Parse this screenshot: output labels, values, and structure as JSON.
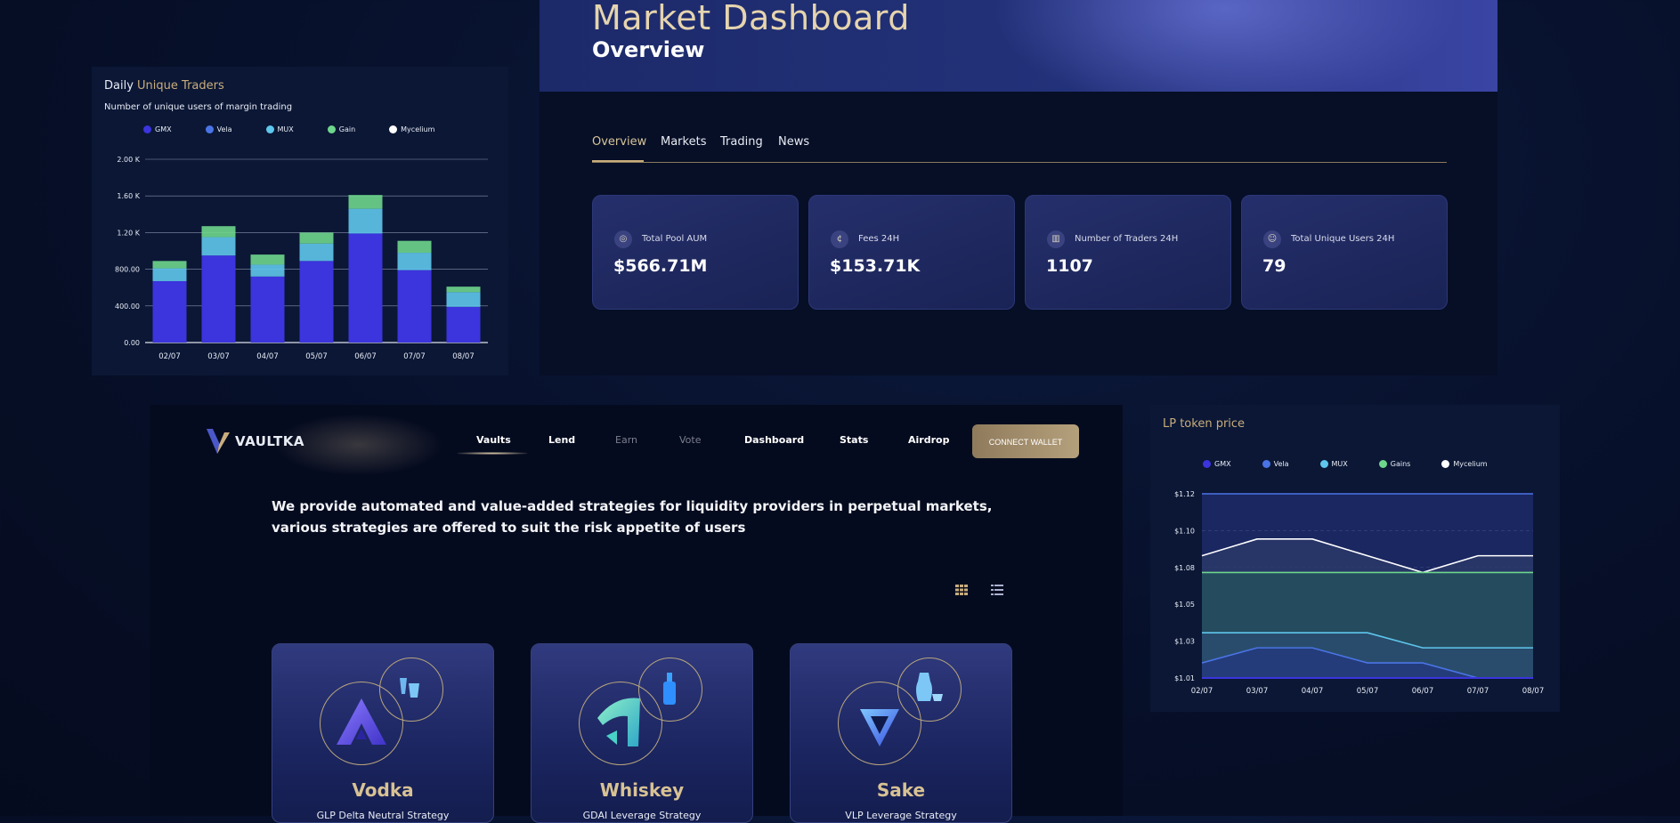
{
  "traders": {
    "title_prefix": "Daily",
    "title_highlight": "Unique Traders",
    "subtitle": "Number of unique users of margin trading",
    "legend": [
      "GMX",
      "Vela",
      "MUX",
      "Gain",
      "Mycelium"
    ]
  },
  "lp": {
    "title": "LP token price",
    "legend": [
      "GMX",
      "Vela",
      "MUX",
      "Gains",
      "Mycelium"
    ]
  },
  "colors": {
    "gmx": "#3c34dd",
    "vela": "#4a74e6",
    "mux": "#5fc6ec",
    "gain": "#6ed68c",
    "mycelium": "#ffffff",
    "gold": "#c9ad7d",
    "panel": "#0b1735"
  },
  "chart_data": [
    {
      "type": "bar",
      "stacked": true,
      "title": "Daily Unique Traders",
      "subtitle": "Number of unique users of margin trading",
      "categories": [
        "02/07",
        "03/07",
        "04/07",
        "05/07",
        "06/07",
        "07/07",
        "08/07"
      ],
      "series": [
        {
          "name": "GMX",
          "values": [
            670,
            950,
            720,
            890,
            1190,
            790,
            390
          ]
        },
        {
          "name": "MUX",
          "values": [
            140,
            200,
            130,
            190,
            270,
            190,
            160
          ]
        },
        {
          "name": "Gain",
          "values": [
            80,
            120,
            110,
            120,
            150,
            130,
            60
          ]
        }
      ],
      "yticks": [
        "0.00",
        "400.00",
        "800.00",
        "1.20 K",
        "1.60 K",
        "2.00 K"
      ],
      "ylim": [
        0,
        2000
      ],
      "legend": [
        "GMX",
        "Vela",
        "MUX",
        "Gain",
        "Mycelium"
      ],
      "legend_position": "top",
      "grid": true
    },
    {
      "type": "area",
      "title": "LP token price",
      "x": [
        "02/07",
        "03/07",
        "04/07",
        "05/07",
        "06/07",
        "07/07",
        "08/07"
      ],
      "series": [
        {
          "name": "Mycelium",
          "values": [
            1.083,
            1.093,
            1.093,
            1.083,
            1.073,
            1.083,
            1.083
          ]
        },
        {
          "name": "Gains",
          "values": [
            1.073,
            1.073,
            1.073,
            1.073,
            1.073,
            1.073,
            1.073
          ]
        },
        {
          "name": "MUX",
          "values": [
            1.037,
            1.037,
            1.037,
            1.037,
            1.028,
            1.028,
            1.028
          ]
        },
        {
          "name": "Vela",
          "values": [
            1.019,
            1.028,
            1.028,
            1.019,
            1.019,
            1.01,
            1.01
          ]
        },
        {
          "name": "GMX",
          "values": [
            1.01,
            1.01,
            1.01,
            1.01,
            1.01,
            1.01,
            1.01
          ]
        }
      ],
      "yticks": [
        "$1.01",
        "$1.03",
        "$1.05",
        "$1.08",
        "$1.10",
        "$1.12"
      ],
      "ylim": [
        1.01,
        1.12
      ],
      "legend": [
        "GMX",
        "Vela",
        "MUX",
        "Gains",
        "Mycelium"
      ],
      "legend_position": "top",
      "grid": true
    }
  ],
  "market": {
    "title": "Market Dashboard",
    "subtitle": "Overview",
    "tabs": [
      "Overview",
      "Markets",
      "Trading",
      "News"
    ],
    "active_tab": "Overview",
    "cards": [
      {
        "label": "Total Pool AUM",
        "value": "$566.71M",
        "icon": "pool-icon"
      },
      {
        "label": "Fees 24H",
        "value": "$153.71K",
        "icon": "fees-icon"
      },
      {
        "label": "Number of Traders 24H",
        "value": "1107",
        "icon": "bar-chart-icon"
      },
      {
        "label": "Total Unique Users 24H",
        "value": "79",
        "icon": "user-icon"
      }
    ]
  },
  "vaultka": {
    "logo": "VAULTKA",
    "nav": [
      "Vaults",
      "Lend",
      "Earn",
      "Vote",
      "Dashboard",
      "Stats",
      "Airdrop"
    ],
    "connect": "CONNECT WALLET",
    "tagline": "We provide automated and value-added strategies for liquidity providers in perpetual markets, various strategies are offered to suit the risk appetite of users",
    "vaults": [
      {
        "name": "Vodka",
        "strategy": "GLP Delta Neutral Strategy"
      },
      {
        "name": "Whiskey",
        "strategy": "GDAI Leverage Strategy"
      },
      {
        "name": "Sake",
        "strategy": "VLP Leverage Strategy"
      }
    ]
  }
}
